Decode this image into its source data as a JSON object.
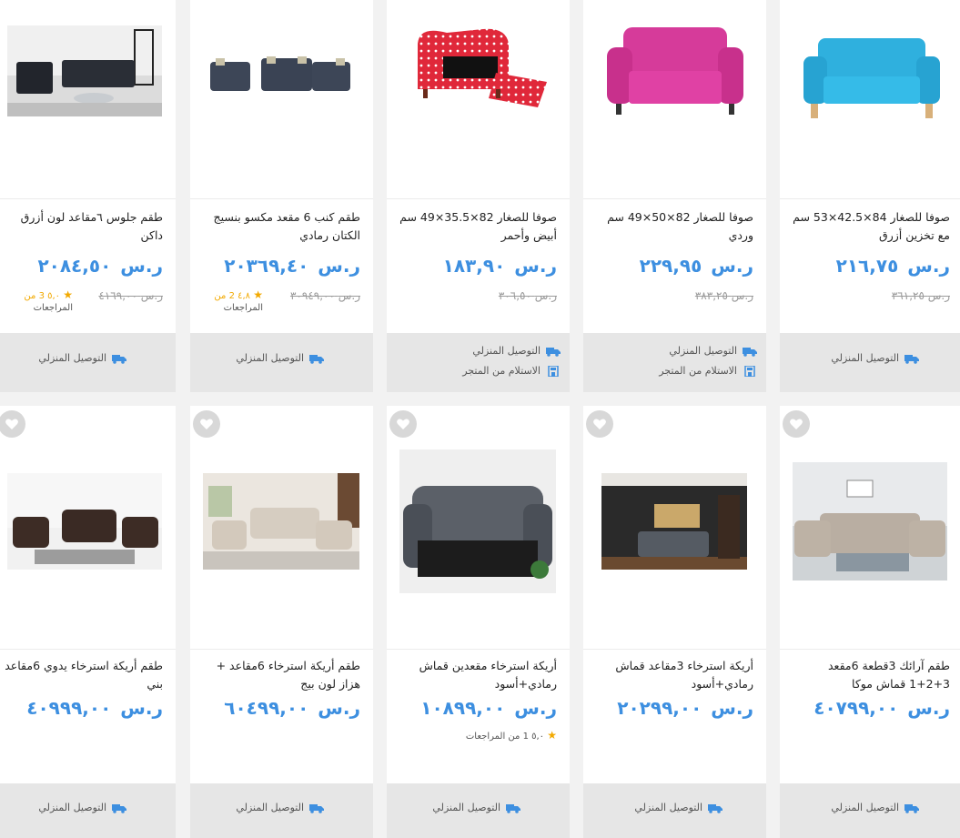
{
  "currency": "ر.س",
  "delivery_label": "التوصيل المنزلي",
  "pickup_label": "الاستلام من المتجر",
  "reviews_label": "المراجعات",
  "accent_color": "#3d8fe0",
  "products": [
    {
      "title": "صوفا للصغار 84×42.5×53 سم مع تخزين أزرق",
      "price": "٢١٦,٧٥",
      "old_price": "٣٦١,٢٥",
      "image": "blue-kids-sofa"
    },
    {
      "title": "صوفا للصغار 82×50×49 سم وردي",
      "price": "٢٢٩,٩٥",
      "old_price": "٣٨٣,٢٥",
      "image": "pink-kids-sofa"
    },
    {
      "title": "صوفا للصغار 82×35.5×49 سم أبيض وأحمر",
      "price": "١٨٣,٩٠",
      "old_price": "٣٠٦,٥٠",
      "image": "red-dotted-kids-sofa"
    },
    {
      "title": "طقم كنب 6 مقعد مكسو بنسيج الكتان رمادي",
      "price": "٢٠٣٦٩,٤٠",
      "old_price": "٣٠٩٤٩,٠٠",
      "rating_text": "٤,٨ 2 من",
      "image": "grey-sofa-set"
    },
    {
      "title": "طقم جلوس ٦مقاعد لون أزرق داكن",
      "price": "٢٠٨٤,٥٠",
      "old_price": "٤١٦٩,٠٠",
      "rating_text": "٥,٠ 3 من",
      "image": "dark-blue-sofa-set"
    },
    {
      "title": "طقم آرائك 3قطعة 6مقعد 3+2+1 قماش موكا",
      "price": "٤٠٧٩٩,٠٠",
      "image": "mocha-recliner-set"
    },
    {
      "title": "أريكة استرخاء 3مقاعد قماش رمادي+أسود",
      "price": "٢٠٢٩٩,٠٠",
      "image": "grey-black-recliner-room"
    },
    {
      "title": "أريكة استرخاء مقعدين قماش رمادي+أسود",
      "price": "١٠٨٩٩,٠٠",
      "rating_text": "٥,٠ 1 من المراجعات",
      "image": "grey-black-loveseat"
    },
    {
      "title": "طقم أريكة استرخاء 6مقاعد + هزاز لون بيج",
      "price": "٦٠٤٩٩,٠٠",
      "image": "beige-recliner-set"
    },
    {
      "title": "طقم أريكة استرخاء يدوي 6مقاعد بني",
      "price": "٤٠٩٩٩,٠٠",
      "image": "brown-recliner-set"
    }
  ]
}
